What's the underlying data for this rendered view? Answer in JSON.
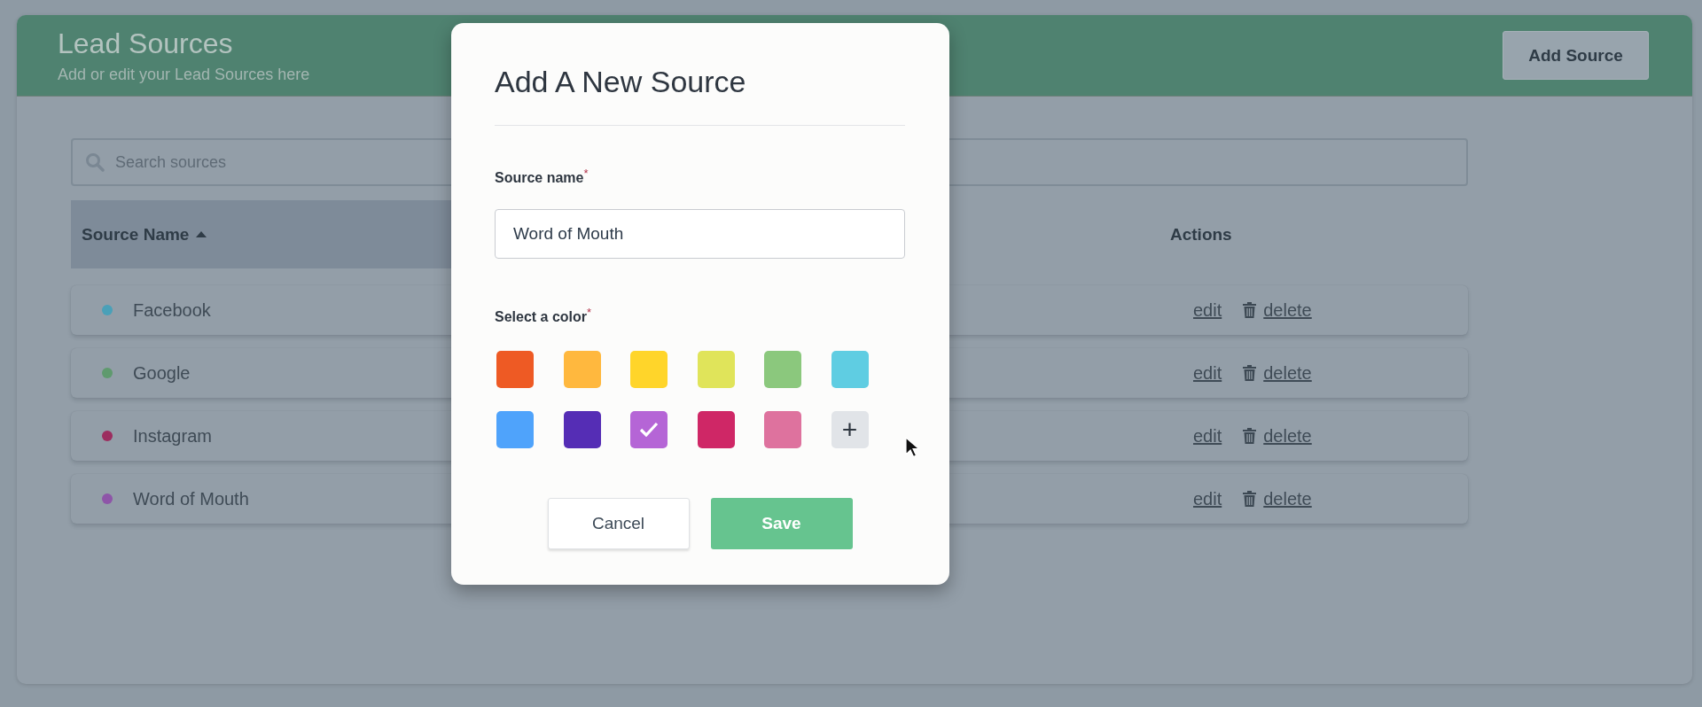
{
  "header": {
    "title": "Lead Sources",
    "subtitle": "Add or edit your Lead Sources here",
    "add_button": "Add Source"
  },
  "search": {
    "placeholder": "Search sources"
  },
  "table": {
    "columns": [
      {
        "label": "Source Name",
        "selected": true
      },
      {
        "label": "Actions",
        "selected": false
      }
    ],
    "rows": [
      {
        "name": "Facebook",
        "color": "#4aa0b8",
        "edit": "edit",
        "delete": "delete"
      },
      {
        "name": "Google",
        "color": "#5f9a6e",
        "edit": "edit",
        "delete": "delete"
      },
      {
        "name": "Instagram",
        "color": "#9c2d5f",
        "edit": "edit",
        "delete": "delete"
      },
      {
        "name": "Word of Mouth",
        "color": "#8e55a8",
        "edit": "edit",
        "delete": "delete"
      }
    ]
  },
  "modal": {
    "title": "Add A New Source",
    "source_name": {
      "label": "Source name",
      "required_mark": "*",
      "value": "Word of Mouth"
    },
    "color_picker": {
      "label": "Select a color",
      "required_mark": "*",
      "add_button": "+",
      "swatches": [
        {
          "color": "#ee5a24",
          "selected": false
        },
        {
          "color": "#ffb83e",
          "selected": false
        },
        {
          "color": "#ffd52a",
          "selected": false
        },
        {
          "color": "#e0e45a",
          "selected": false
        },
        {
          "color": "#8bc87d",
          "selected": false
        },
        {
          "color": "#5fcde2",
          "selected": false
        },
        {
          "color": "#4fa3fb",
          "selected": false
        },
        {
          "color": "#552db5",
          "selected": false
        },
        {
          "color": "#b565d6",
          "selected": true
        },
        {
          "color": "#cf2766",
          "selected": false
        },
        {
          "color": "#de729e",
          "selected": false
        }
      ]
    },
    "buttons": [
      {
        "label": "Cancel",
        "kind": "secondary"
      },
      {
        "label": "Save",
        "kind": "primary"
      }
    ]
  }
}
